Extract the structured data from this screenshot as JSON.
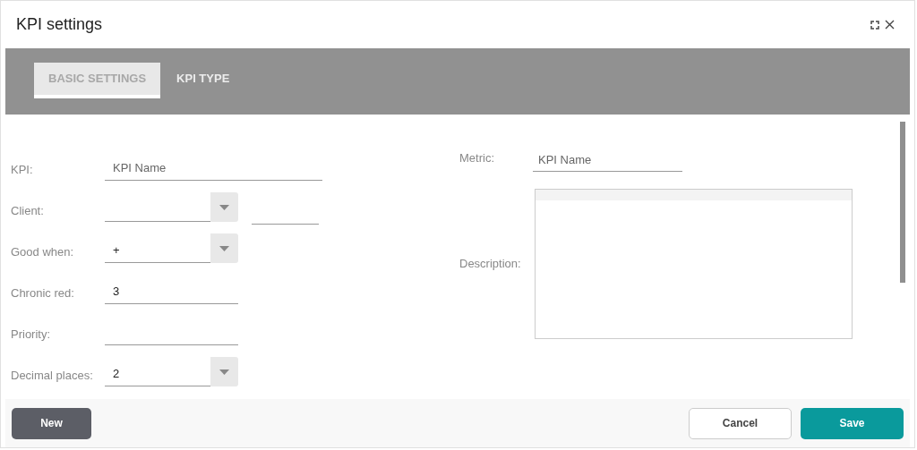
{
  "window": {
    "title": "KPI settings"
  },
  "tabs": [
    {
      "label": "BASIC SETTINGS",
      "selected": true
    },
    {
      "label": "KPI TYPE",
      "selected": false
    }
  ],
  "left_fields": [
    {
      "label": "KPI:",
      "kind": "wide_text",
      "placeholder": "KPI Name"
    },
    {
      "label": "Client:",
      "kind": "dropdown_extra"
    },
    {
      "label": "Good when:",
      "kind": "dropdown",
      "value": "+"
    },
    {
      "label": "Chronic red:",
      "kind": "text",
      "value": "3"
    },
    {
      "label": "Priority:",
      "kind": "text"
    },
    {
      "label": "Decimal places:",
      "kind": "dropdown",
      "value": "2"
    }
  ],
  "metric": {
    "label": "Metric:",
    "placeholder": "KPI Name"
  },
  "description": {
    "label": "Description:"
  },
  "buttons": [
    {
      "label": "New",
      "kind": "dark"
    },
    {
      "label": "Cancel",
      "kind": "outline"
    },
    {
      "label": "Save",
      "kind": "primary"
    }
  ]
}
